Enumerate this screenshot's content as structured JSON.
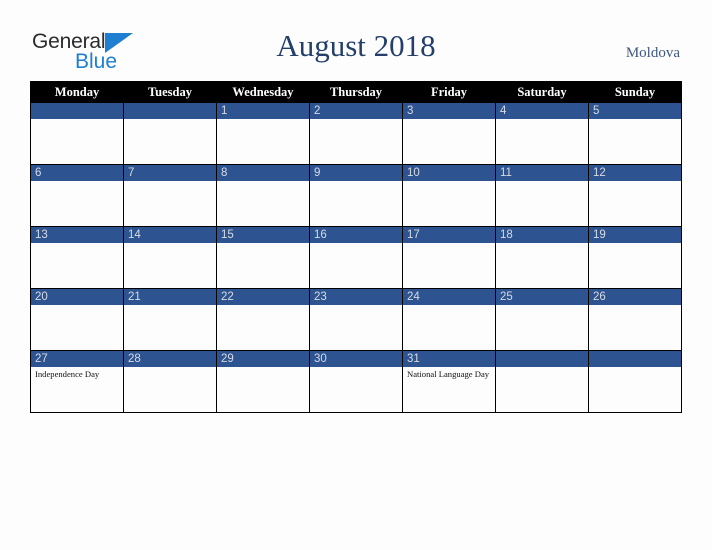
{
  "brand": {
    "name_part1": "General",
    "name_part2": "Blue",
    "triangle_color": "#1e7fd0",
    "text_color": "#2b2b2b"
  },
  "header": {
    "title": "August 2018",
    "country": "Moldova",
    "title_color": "#253f6b",
    "country_color": "#3e5784"
  },
  "calendar": {
    "day_header_bg": "#000000",
    "day_header_color": "#ffffff",
    "day_number_bg": "#2d5490",
    "day_number_color": "#d7dbe3",
    "cell_bg": "#fdfdfd",
    "weekdays": [
      "Monday",
      "Tuesday",
      "Wednesday",
      "Thursday",
      "Friday",
      "Saturday",
      "Sunday"
    ],
    "weeks": [
      [
        {
          "day": "",
          "events": []
        },
        {
          "day": "",
          "events": []
        },
        {
          "day": "1",
          "events": []
        },
        {
          "day": "2",
          "events": []
        },
        {
          "day": "3",
          "events": []
        },
        {
          "day": "4",
          "events": []
        },
        {
          "day": "5",
          "events": []
        }
      ],
      [
        {
          "day": "6",
          "events": []
        },
        {
          "day": "7",
          "events": []
        },
        {
          "day": "8",
          "events": []
        },
        {
          "day": "9",
          "events": []
        },
        {
          "day": "10",
          "events": []
        },
        {
          "day": "11",
          "events": []
        },
        {
          "day": "12",
          "events": []
        }
      ],
      [
        {
          "day": "13",
          "events": []
        },
        {
          "day": "14",
          "events": []
        },
        {
          "day": "15",
          "events": []
        },
        {
          "day": "16",
          "events": []
        },
        {
          "day": "17",
          "events": []
        },
        {
          "day": "18",
          "events": []
        },
        {
          "day": "19",
          "events": []
        }
      ],
      [
        {
          "day": "20",
          "events": []
        },
        {
          "day": "21",
          "events": []
        },
        {
          "day": "22",
          "events": []
        },
        {
          "day": "23",
          "events": []
        },
        {
          "day": "24",
          "events": []
        },
        {
          "day": "25",
          "events": []
        },
        {
          "day": "26",
          "events": []
        }
      ],
      [
        {
          "day": "27",
          "events": [
            "Independence Day"
          ]
        },
        {
          "day": "28",
          "events": []
        },
        {
          "day": "29",
          "events": []
        },
        {
          "day": "30",
          "events": []
        },
        {
          "day": "31",
          "events": [
            "National Language Day"
          ]
        },
        {
          "day": "",
          "events": []
        },
        {
          "day": "",
          "events": []
        }
      ]
    ]
  }
}
